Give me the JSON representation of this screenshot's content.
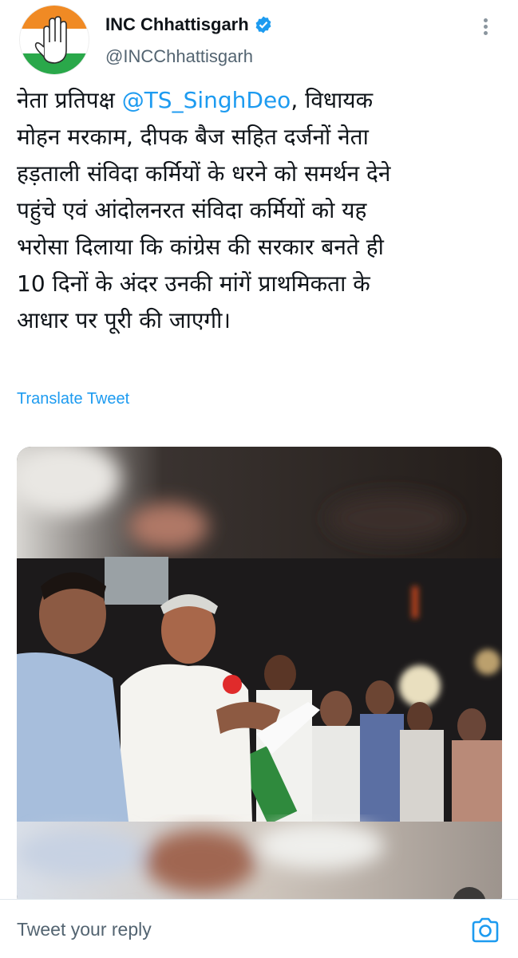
{
  "tweet": {
    "author": {
      "display_name": "INC Chhattisgarh",
      "handle": "@INCChhattisgarh",
      "verified": true
    },
    "text": {
      "line1_pre": "नेता प्रतिपक्ष ",
      "mention": "@TS_SinghDeo",
      "line1_post": ", विधायक",
      "line2": "मोहन मरकाम, दीपक बैज सहित दर्जनों नेता",
      "line3": "हड़ताली संविदा कर्मियों के धरने को समर्थन देने",
      "line4": "पहुंचे एवं आंदोलनरत संविदा कर्मियों को यह",
      "line5": "भरोसा दिलाया कि कांग्रेस की सरकार बनते ही",
      "line6": "10 दिनों के अंदर उनकी मांगें प्राथमिकता के",
      "line7": "आधार पर पूरी की जाएगी।"
    },
    "translate_label": "Translate Tweet"
  },
  "reply": {
    "placeholder": "Tweet your reply"
  },
  "icons": {
    "verified": "verified-badge-icon",
    "more": "more-vertical-icon",
    "camera": "camera-icon"
  },
  "colors": {
    "accent": "#1d9bf0",
    "text": "#0f1419",
    "secondary": "#536471",
    "saffron": "#f08a24",
    "green": "#2aa84a"
  }
}
